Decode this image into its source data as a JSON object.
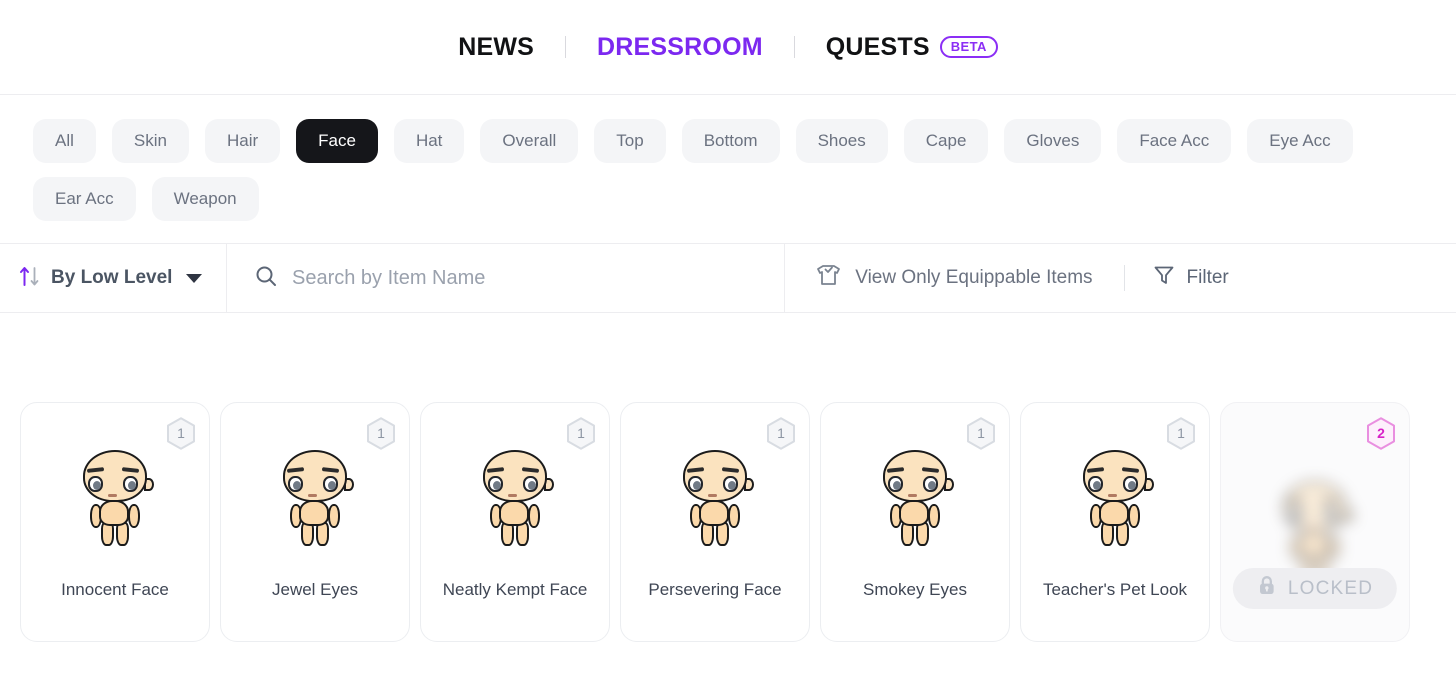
{
  "nav": {
    "items": [
      {
        "label": "NEWS",
        "active": false,
        "badge": null
      },
      {
        "label": "DRESSROOM",
        "active": true,
        "badge": null
      },
      {
        "label": "QUESTS",
        "active": false,
        "badge": "BETA"
      }
    ]
  },
  "categories": {
    "active": "Face",
    "items": [
      "All",
      "Skin",
      "Hair",
      "Face",
      "Hat",
      "Overall",
      "Top",
      "Bottom",
      "Shoes",
      "Cape",
      "Gloves",
      "Face Acc",
      "Eye Acc",
      "Ear Acc",
      "Weapon"
    ]
  },
  "toolbar": {
    "sort_label": "By Low Level",
    "sort_icon": "sort-arrows-icon",
    "caret_icon": "chevron-down-icon",
    "search_icon": "search-icon",
    "search_value": "",
    "search_placeholder": "Search by Item Name",
    "equip_icon": "tshirt-check-icon",
    "equip_label": "View Only Equippable Items",
    "filter_icon": "funnel-icon",
    "filter_label": "Filter"
  },
  "items": [
    {
      "name": "Innocent Face",
      "level": "1",
      "locked": false,
      "rare": false
    },
    {
      "name": "Jewel Eyes",
      "level": "1",
      "locked": false,
      "rare": false
    },
    {
      "name": "Neatly Kempt Face",
      "level": "1",
      "locked": false,
      "rare": false
    },
    {
      "name": "Persevering Face",
      "level": "1",
      "locked": false,
      "rare": false
    },
    {
      "name": "Smokey Eyes",
      "level": "1",
      "locked": false,
      "rare": false
    },
    {
      "name": "Teacher's Pet Look",
      "level": "1",
      "locked": false,
      "rare": false
    },
    {
      "name": "",
      "level": "2",
      "locked": true,
      "rare": true
    }
  ],
  "locked": {
    "label": "LOCKED",
    "icon": "lock-icon"
  },
  "colors": {
    "accent_purple": "#7c28f0",
    "beta_purple": "#8b2ef5",
    "chip_bg": "#f4f5f7",
    "chip_active_bg": "#15161a",
    "rare_pink": "#d822c8",
    "text_muted": "#6b7280"
  }
}
